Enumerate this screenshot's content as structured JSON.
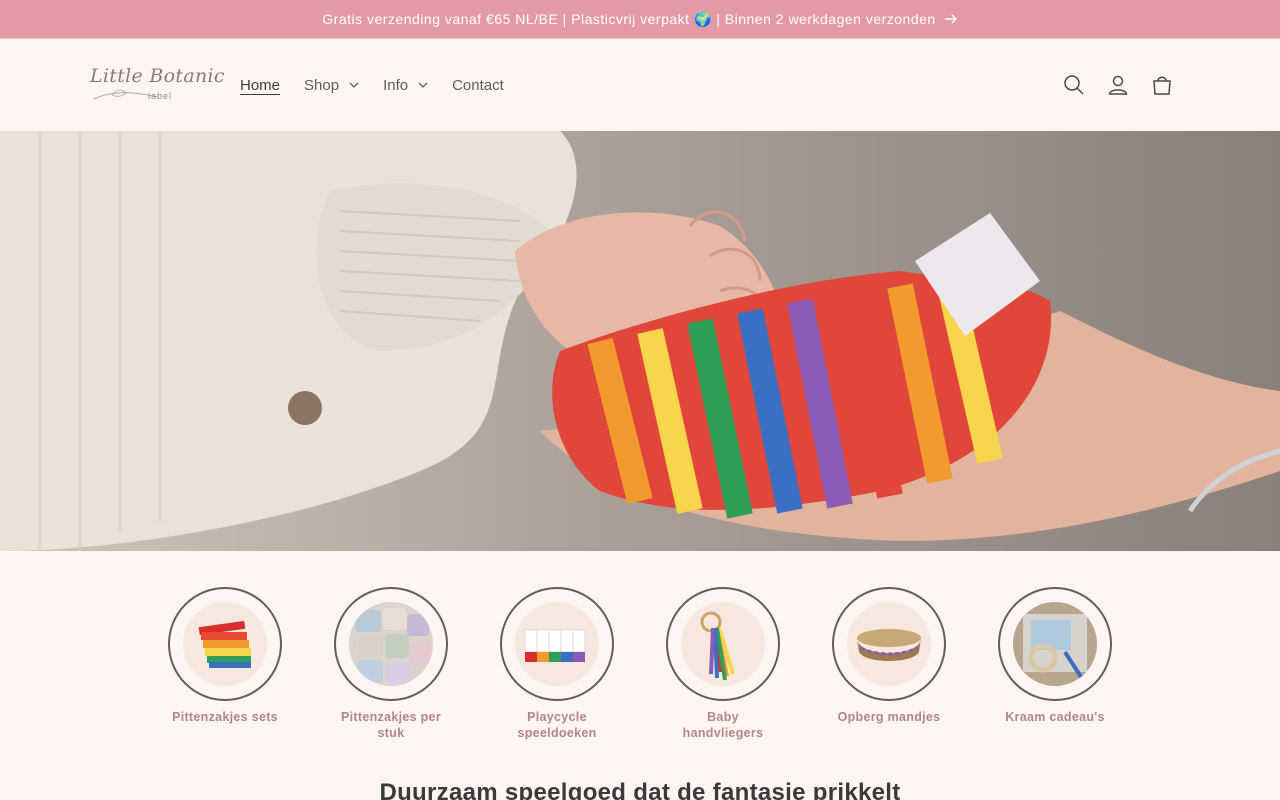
{
  "announcement": {
    "text": "Gratis verzending vanaf €65 NL/BE | Plasticvrij verpakt 🌍 | Binnen 2 werkdagen verzonden",
    "arrow_icon": "arrow-right-icon"
  },
  "header": {
    "logo": {
      "script": "Little Botanic",
      "sub": "label"
    },
    "nav": [
      {
        "label": "Home",
        "active": true
      },
      {
        "label": "Shop",
        "has_dropdown": true
      },
      {
        "label": "Info",
        "has_dropdown": true
      },
      {
        "label": "Contact"
      }
    ],
    "icons": [
      "search-icon",
      "account-icon",
      "cart-icon"
    ]
  },
  "hero": {
    "image": "hand-holding-rainbow-pouch"
  },
  "categories": [
    {
      "label": "Pittenzakjes sets"
    },
    {
      "label": "Pittenzakjes per stuk"
    },
    {
      "label": "Playcycle speeldoeken"
    },
    {
      "label": "Baby handvliegers"
    },
    {
      "label": "Opberg mandjes"
    },
    {
      "label": "Kraam cadeau's"
    }
  ],
  "headline": "Duurzaam speelgoed dat de fantasie prikkelt",
  "colors": {
    "announcement_bg": "#e49aa6",
    "page_bg": "#fdf5f1",
    "category_label": "#b48686",
    "circle_border": "#6b5a5a"
  }
}
